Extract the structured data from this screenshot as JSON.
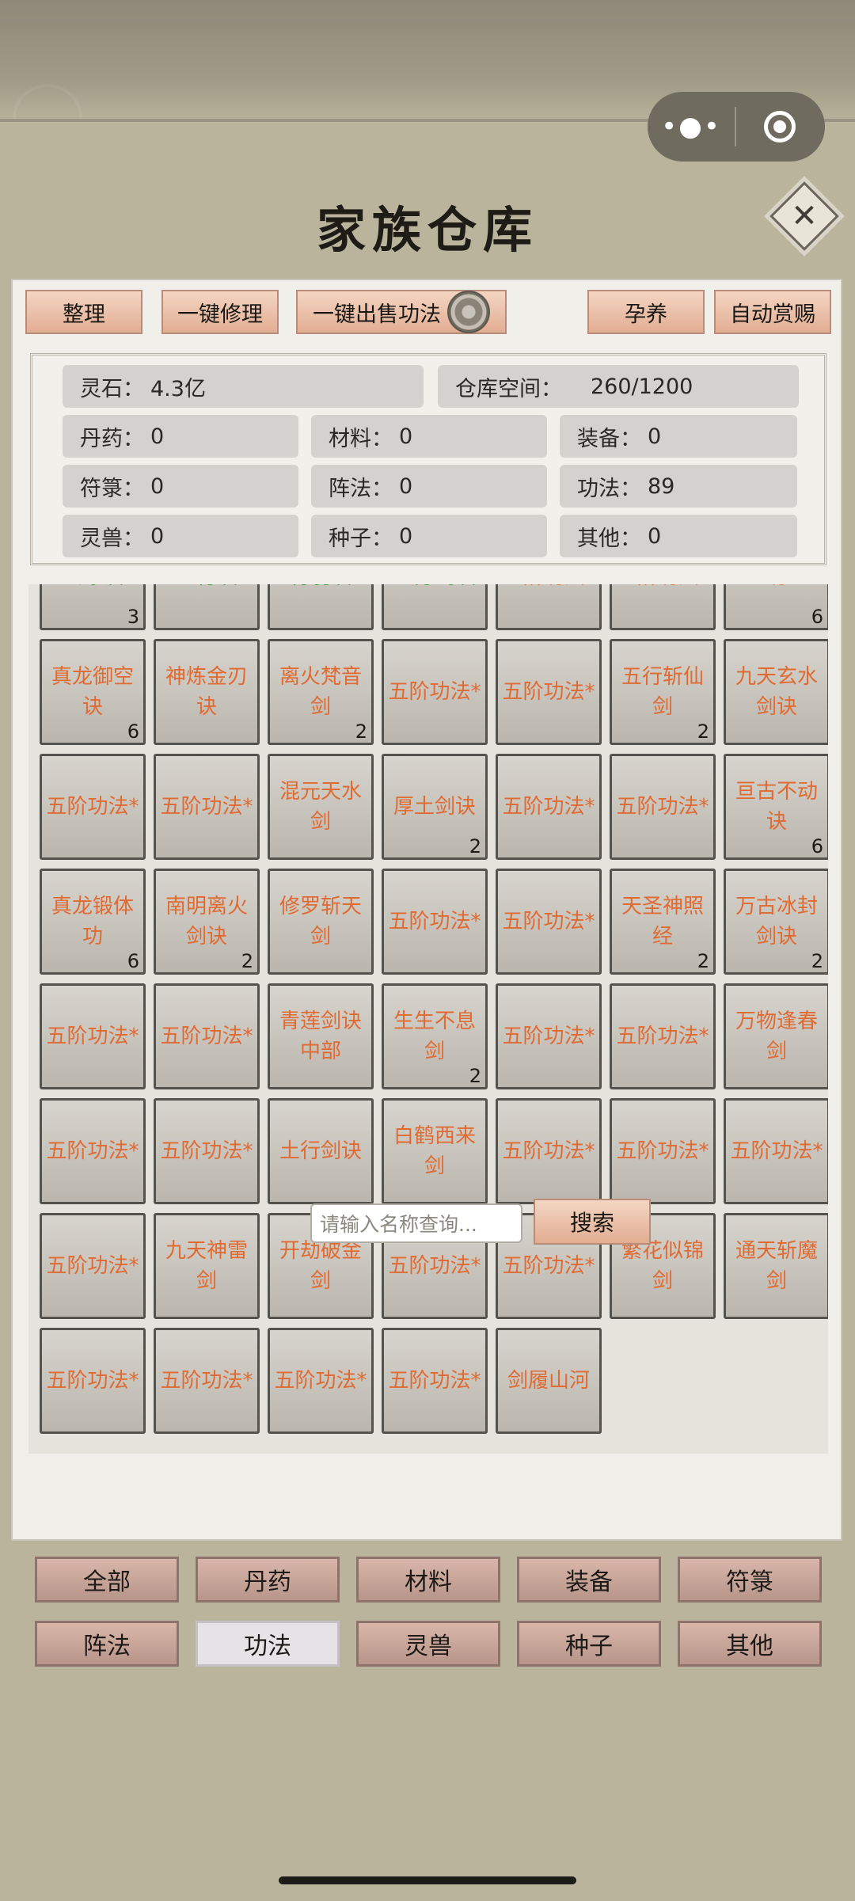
{
  "capsule": {
    "more_icon": "more-dots-icon",
    "close_icon": "record-circle-icon"
  },
  "header": {
    "title": "家族仓库",
    "close_label": "✕"
  },
  "toolbar": {
    "organize": "整理",
    "repair_all": "一键修理",
    "sell_all_techniques": "一键出售功法",
    "settings_icon": "gear-icon",
    "nurture": "孕养",
    "auto_reward": "自动赏赐"
  },
  "stats": {
    "spirit_stone": {
      "label": "灵石：",
      "value": "4.3亿"
    },
    "storage": {
      "label": "仓库空间：",
      "value": "260/1200"
    },
    "pills": {
      "label": "丹药：",
      "value": "0"
    },
    "materials": {
      "label": "材料：",
      "value": "0"
    },
    "equipment": {
      "label": "装备：",
      "value": "0"
    },
    "talismans": {
      "label": "符箓：",
      "value": "0"
    },
    "formations": {
      "label": "阵法：",
      "value": "0"
    },
    "techniques": {
      "label": "功法：",
      "value": "89"
    },
    "beasts": {
      "label": "灵兽：",
      "value": "0"
    },
    "seeds": {
      "label": "种子：",
      "value": "0"
    },
    "others": {
      "label": "其他：",
      "value": "0"
    }
  },
  "items": [
    {
      "name": "玄冰诀",
      "count": "3",
      "color": "green"
    },
    {
      "name": "土行诀",
      "count": "",
      "color": "green"
    },
    {
      "name": "青羽诀",
      "count": "",
      "color": "green"
    },
    {
      "name": "三分剑诀",
      "count": "",
      "color": "green"
    },
    {
      "name": "五阶功法*",
      "count": "",
      "color": "orange"
    },
    {
      "name": "五阶功法*",
      "count": "",
      "color": "orange"
    },
    {
      "name": "功",
      "count": "6",
      "color": "orange"
    },
    {
      "name": "真龙御空诀",
      "count": "6",
      "color": "orange"
    },
    {
      "name": "神炼金刃诀",
      "count": "",
      "color": "orange"
    },
    {
      "name": "离火梵音剑",
      "count": "2",
      "color": "orange"
    },
    {
      "name": "五阶功法*",
      "count": "",
      "color": "orange"
    },
    {
      "name": "五阶功法*",
      "count": "",
      "color": "orange"
    },
    {
      "name": "五行斩仙剑",
      "count": "2",
      "color": "orange"
    },
    {
      "name": "九天玄水剑诀",
      "count": "",
      "color": "orange"
    },
    {
      "name": "五阶功法*",
      "count": "",
      "color": "orange"
    },
    {
      "name": "五阶功法*",
      "count": "",
      "color": "orange"
    },
    {
      "name": "混元天水剑",
      "count": "",
      "color": "orange"
    },
    {
      "name": "厚土剑诀",
      "count": "2",
      "color": "orange"
    },
    {
      "name": "五阶功法*",
      "count": "",
      "color": "orange"
    },
    {
      "name": "五阶功法*",
      "count": "",
      "color": "orange"
    },
    {
      "name": "亘古不动诀",
      "count": "6",
      "color": "orange"
    },
    {
      "name": "真龙锻体功",
      "count": "6",
      "color": "orange"
    },
    {
      "name": "南明离火剑诀",
      "count": "2",
      "color": "orange"
    },
    {
      "name": "修罗斩天剑",
      "count": "",
      "color": "orange"
    },
    {
      "name": "五阶功法*",
      "count": "",
      "color": "orange"
    },
    {
      "name": "五阶功法*",
      "count": "",
      "color": "orange"
    },
    {
      "name": "天圣神照经",
      "count": "2",
      "color": "orange"
    },
    {
      "name": "万古冰封剑诀",
      "count": "2",
      "color": "orange"
    },
    {
      "name": "五阶功法*",
      "count": "",
      "color": "orange"
    },
    {
      "name": "五阶功法*",
      "count": "",
      "color": "orange"
    },
    {
      "name": "青莲剑诀中部",
      "count": "",
      "color": "orange"
    },
    {
      "name": "生生不息剑",
      "count": "2",
      "color": "orange"
    },
    {
      "name": "五阶功法*",
      "count": "",
      "color": "orange"
    },
    {
      "name": "五阶功法*",
      "count": "",
      "color": "orange"
    },
    {
      "name": "万物逢春剑",
      "count": "",
      "color": "orange"
    },
    {
      "name": "五阶功法*",
      "count": "",
      "color": "orange"
    },
    {
      "name": "五阶功法*",
      "count": "",
      "color": "orange"
    },
    {
      "name": "土行剑诀",
      "count": "",
      "color": "orange"
    },
    {
      "name": "白鹤西来剑",
      "count": "",
      "color": "orange"
    },
    {
      "name": "五阶功法*",
      "count": "",
      "color": "orange"
    },
    {
      "name": "五阶功法*",
      "count": "",
      "color": "orange"
    },
    {
      "name": "五阶功法*",
      "count": "",
      "color": "orange"
    },
    {
      "name": "五阶功法*",
      "count": "",
      "color": "orange"
    },
    {
      "name": "九天神雷剑",
      "count": "",
      "color": "orange"
    },
    {
      "name": "开劫破金剑",
      "count": "",
      "color": "orange"
    },
    {
      "name": "五阶功法*",
      "count": "",
      "color": "orange"
    },
    {
      "name": "五阶功法*",
      "count": "",
      "color": "orange"
    },
    {
      "name": "繁花似锦剑",
      "count": "",
      "color": "orange"
    },
    {
      "name": "通天斩魔剑",
      "count": "",
      "color": "orange"
    },
    {
      "name": "五阶功法*",
      "count": "",
      "color": "orange"
    },
    {
      "name": "五阶功法*",
      "count": "",
      "color": "orange"
    },
    {
      "name": "五阶功法*",
      "count": "",
      "color": "orange"
    },
    {
      "name": "五阶功法*",
      "count": "",
      "color": "orange"
    },
    {
      "name": "剑履山河",
      "count": "",
      "color": "orange"
    }
  ],
  "search": {
    "placeholder": "请输入名称查询...",
    "button": "搜索"
  },
  "tabs": [
    "全部",
    "丹药",
    "材料",
    "装备",
    "符箓",
    "阵法",
    "功法",
    "灵兽",
    "种子",
    "其他"
  ],
  "active_tab": "功法",
  "colors": {
    "item_orange": "#df6a32",
    "item_green": "#3d9c3d",
    "button": "#e8b89f"
  }
}
